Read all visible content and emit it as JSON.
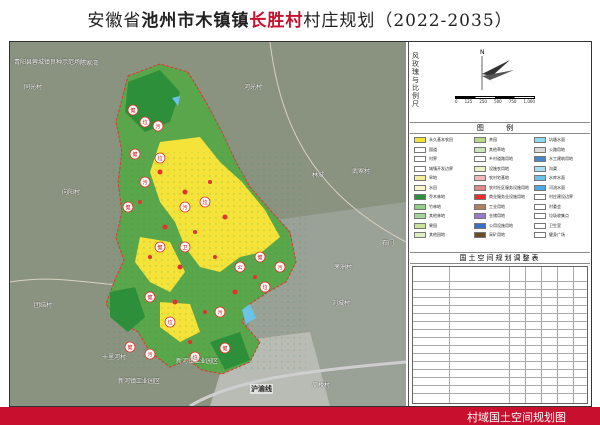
{
  "title": {
    "prefix": "安徽省",
    "city_town": "池州市木镇镇",
    "village": "长胜村",
    "suffix": "村庄规划（2022-2035）"
  },
  "side": {
    "vertical_text": "风玫瑰与比例尺",
    "legend_heading": "图 例",
    "table_heading": "国土空间规划调整表",
    "scale_numbers": [
      "0",
      "125",
      "250",
      "500",
      "750",
      "1,000"
    ]
  },
  "legend_items_left": [
    {
      "label": "永久基本农田",
      "color": "#f5e33a"
    },
    {
      "label": "国道",
      "color": "#ffffff"
    },
    {
      "label": "村界",
      "color": "#ffffff"
    },
    {
      "label": "城镇开发边界",
      "color": "#ffffff"
    },
    {
      "label": "旱地",
      "color": "#f4ef9a"
    },
    {
      "label": "水田",
      "color": "#fbf4c8"
    },
    {
      "label": "乔木林地",
      "color": "#2e8f3b"
    },
    {
      "label": "竹林地",
      "color": "#8ed085"
    },
    {
      "label": "其他林地",
      "color": "#a7d39c"
    },
    {
      "label": "果园",
      "color": "#c9e29a"
    },
    {
      "label": "其他园地",
      "color": "#dfeec0"
    }
  ],
  "legend_items_mid": [
    {
      "label": "茶园",
      "color": "#b9d98a"
    },
    {
      "label": "其他草地",
      "color": "#c8e6b8"
    },
    {
      "label": "乡村道路用地",
      "color": "#ffffff"
    },
    {
      "label": "设施农用地",
      "color": "#e8f0c4"
    },
    {
      "label": "农村宅基地",
      "color": "#f2b8b8"
    },
    {
      "label": "农村社区服务设施用地",
      "color": "#e08a8a"
    },
    {
      "label": "商业服务业设施用地",
      "color": "#ee2a2a"
    },
    {
      "label": "工业用地",
      "color": "#b08060"
    },
    {
      "label": "仓储用地",
      "color": "#9a7acc"
    },
    {
      "label": "公用设施用地",
      "color": "#3a6fc9"
    },
    {
      "label": "采矿用地",
      "color": "#6b4a2a"
    }
  ],
  "legend_items_right": [
    {
      "label": "坑塘水面",
      "color": "#8fd6f0"
    },
    {
      "label": "公路用地",
      "color": "#d9d9d9"
    },
    {
      "label": "水工建筑用地",
      "color": "#4a86c8"
    },
    {
      "label": "沟渠",
      "color": "#a9dcf0"
    },
    {
      "label": "水库水面",
      "color": "#6cc3e8"
    },
    {
      "label": "河流水面",
      "color": "#4aa9e0"
    },
    {
      "label": "村庄建设边界",
      "color": "#ffffff"
    },
    {
      "label": "村委会",
      "color": "#ffffff"
    },
    {
      "label": "垃圾收集点",
      "color": "#ffffff"
    },
    {
      "label": "卫生室",
      "color": "#ffffff"
    },
    {
      "label": "健身广场",
      "color": "#ffffff"
    }
  ],
  "map_labels": [
    {
      "text": "青阳县蓉城镇良种示范场村"
    },
    {
      "text": "陈家湾"
    },
    {
      "text": "同光村"
    },
    {
      "text": "河光村"
    },
    {
      "text": "向阳村"
    },
    {
      "text": "武家村"
    },
    {
      "text": "石门"
    },
    {
      "text": "团结村"
    },
    {
      "text": "十里河村"
    },
    {
      "text": "新河镇工业园区"
    },
    {
      "text": "新河镇工业园区"
    },
    {
      "text": "周桥村"
    },
    {
      "text": "茅洲村"
    },
    {
      "text": "刘城村"
    },
    {
      "text": "沪渝线"
    },
    {
      "text": "林城"
    }
  ],
  "facility_marks": [
    "健",
    "垃",
    "污",
    "卫",
    "公"
  ],
  "bottom_caption": "村域国土空间规划图"
}
